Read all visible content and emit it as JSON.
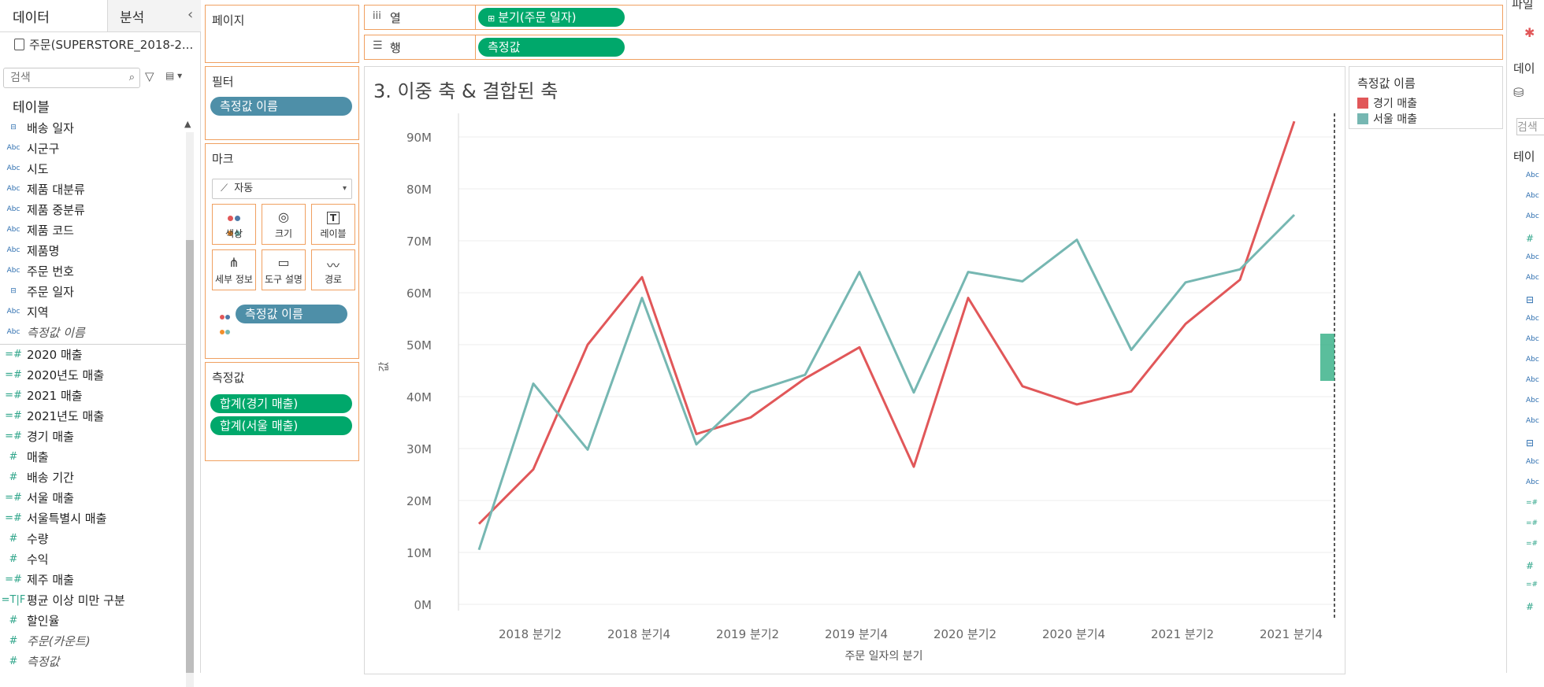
{
  "data_pane": {
    "tabs": [
      "데이터",
      "분석"
    ],
    "collapse_glyph": "‹",
    "datasource": "주문(SUPERSTORE_2018-2...",
    "search_placeholder": "검색",
    "section": "테이블",
    "dimensions": [
      {
        "icon": "calendar-icon",
        "type": "date",
        "label": "배송 일자"
      },
      {
        "icon": "abc-icon",
        "type": "Abc",
        "label": "시군구"
      },
      {
        "icon": "abc-icon",
        "type": "Abc",
        "label": "시도"
      },
      {
        "icon": "abc-icon",
        "type": "Abc",
        "label": "제품 대분류"
      },
      {
        "icon": "abc-icon",
        "type": "Abc",
        "label": "제품 중분류"
      },
      {
        "icon": "abc-icon",
        "type": "Abc",
        "label": "제품 코드"
      },
      {
        "icon": "abc-icon",
        "type": "Abc",
        "label": "제품명"
      },
      {
        "icon": "abc-icon",
        "type": "Abc",
        "label": "주문 번호"
      },
      {
        "icon": "calendar-icon",
        "type": "date",
        "label": "주문 일자"
      },
      {
        "icon": "abc-icon",
        "type": "Abc",
        "label": "지역"
      },
      {
        "icon": "abc-icon",
        "type": "Abc",
        "label": "측정값 이름",
        "italic": true
      }
    ],
    "measures": [
      {
        "icon": "calc-number-icon",
        "label": "2020 매출"
      },
      {
        "icon": "calc-number-icon",
        "label": "2020년도 매출"
      },
      {
        "icon": "calc-number-icon",
        "label": "2021 매출"
      },
      {
        "icon": "calc-number-icon",
        "label": "2021년도 매출"
      },
      {
        "icon": "calc-number-icon",
        "label": "경기 매출"
      },
      {
        "icon": "number-icon",
        "label": "매출"
      },
      {
        "icon": "number-icon",
        "label": "배송 기간"
      },
      {
        "icon": "calc-number-icon",
        "label": "서울 매출"
      },
      {
        "icon": "calc-number-icon",
        "label": "서울특별시 매출"
      },
      {
        "icon": "number-icon",
        "label": "수량"
      },
      {
        "icon": "number-icon",
        "label": "수익"
      },
      {
        "icon": "calc-number-icon",
        "label": "제주 매출"
      },
      {
        "icon": "tf-icon",
        "label": "평균 이상 미만 구분"
      },
      {
        "icon": "number-icon",
        "label": "할인율"
      },
      {
        "icon": "number-icon",
        "label": "주문(카운트)",
        "italic": true
      },
      {
        "icon": "number-icon",
        "label": "측정값",
        "italic": true
      }
    ]
  },
  "shelves": {
    "pages_title": "페이지",
    "columns_label": "열",
    "columns_pill": "분기(주문 일자)",
    "rows_label": "행",
    "rows_pill": "측정값",
    "filters_title": "필터",
    "filters_pill": "측정값 이름",
    "marks_title": "마크",
    "mark_type": "자동",
    "mark_buttons": [
      "색상",
      "크기",
      "레이블",
      "세부 정보",
      "도구 설명",
      "경로"
    ],
    "marks_pill": "측정값 이름",
    "measure_values_title": "측정값",
    "measure_values_pills": [
      "합계(경기 매출)",
      "합계(서울 매출)"
    ]
  },
  "chart_title": "3. 이중 축 & 결합된 축",
  "legend": {
    "title": "측정값 이름",
    "items": [
      {
        "label": "경기 매출",
        "color": "#e15759"
      },
      {
        "label": "서울 매출",
        "color": "#76b7b2"
      }
    ]
  },
  "right_pane": {
    "fragments": [
      "파일",
      "데이",
      "검색",
      "테이"
    ]
  },
  "chart_data": {
    "type": "line",
    "title": "3. 이중 축 & 결합된 축",
    "xlabel": "주문 일자의 분기",
    "ylabel": "값",
    "x": [
      "2018 분기1",
      "2018 분기2",
      "2018 분기3",
      "2018 분기4",
      "2019 분기1",
      "2019 분기2",
      "2019 분기3",
      "2019 분기4",
      "2020 분기1",
      "2020 분기2",
      "2020 분기3",
      "2020 분기4",
      "2021 분기1",
      "2021 분기2",
      "2021 분기3",
      "2021 분기4"
    ],
    "tick_labels": [
      "2018 분기2",
      "2018 분기4",
      "2019 분기2",
      "2019 분기4",
      "2020 분기2",
      "2020 분기4",
      "2021 분기2",
      "2021 분기4"
    ],
    "y_ticks": [
      "0M",
      "10M",
      "20M",
      "30M",
      "40M",
      "50M",
      "60M",
      "70M",
      "80M",
      "90M"
    ],
    "ylim": [
      0,
      95
    ],
    "grid": true,
    "series": [
      {
        "name": "경기 매출",
        "color": "#e15759",
        "values": [
          15.5,
          26.0,
          50.0,
          63.0,
          32.8,
          36.0,
          43.5,
          49.5,
          26.5,
          59.0,
          42.0,
          38.5,
          41.0,
          54.0,
          62.5,
          93.0
        ]
      },
      {
        "name": "서울 매출",
        "color": "#76b7b2",
        "values": [
          10.5,
          42.5,
          29.8,
          59.0,
          30.8,
          40.8,
          44.2,
          64.0,
          40.8,
          64.0,
          62.2,
          70.2,
          49.0,
          62.0,
          64.5,
          75.0
        ]
      }
    ]
  }
}
